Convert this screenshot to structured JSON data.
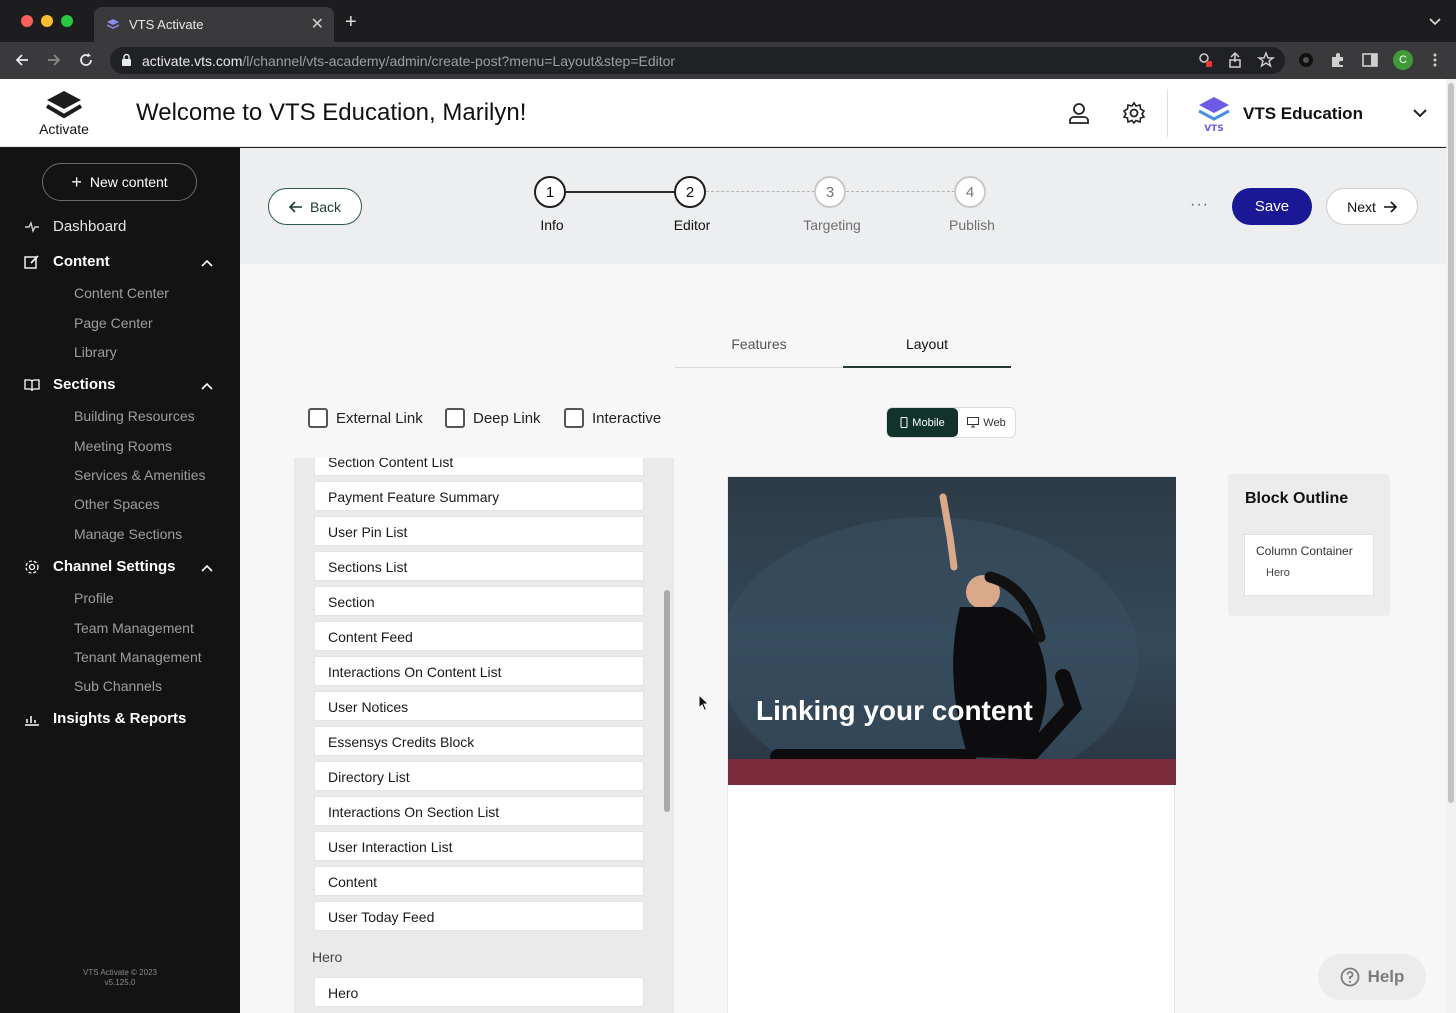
{
  "browser": {
    "tab_title": "VTS Activate",
    "url_host": "activate.vts.com",
    "url_path": "/l/channel/vts-academy/admin/create-post?menu=Layout&step=Editor",
    "profile_initial": "C"
  },
  "header": {
    "logo_text": "Activate",
    "welcome": "Welcome to VTS Education, Marilyn!",
    "org_name": "VTS Education"
  },
  "sidebar": {
    "new_content": "New content",
    "dashboard": "Dashboard",
    "content": "Content",
    "content_items": [
      "Content Center",
      "Page Center",
      "Library"
    ],
    "sections": "Sections",
    "sections_items": [
      "Building Resources",
      "Meeting Rooms",
      "Services & Amenities",
      "Other Spaces",
      "Manage Sections"
    ],
    "channel_settings": "Channel Settings",
    "channel_items": [
      "Profile",
      "Team Management",
      "Tenant Management",
      "Sub Channels"
    ],
    "insights": "Insights & Reports",
    "footer_line1": "VTS Activate © 2023",
    "footer_line2": "v5.125.0"
  },
  "stepper": {
    "back": "Back",
    "steps": [
      {
        "num": "1",
        "label": "Info"
      },
      {
        "num": "2",
        "label": "Editor"
      },
      {
        "num": "3",
        "label": "Targeting"
      },
      {
        "num": "4",
        "label": "Publish"
      }
    ],
    "more": "···",
    "save": "Save",
    "next": "Next"
  },
  "tabs": {
    "features": "Features",
    "layout": "Layout"
  },
  "filters": {
    "external_link": "External Link",
    "deep_link": "Deep Link",
    "interactive": "Interactive"
  },
  "view_toggle": {
    "mobile": "Mobile",
    "web": "Web"
  },
  "blocks": {
    "partial_item": "Section Content List",
    "items": [
      "Payment Feature Summary",
      "User Pin List",
      "Sections List",
      "Section",
      "Content Feed",
      "Interactions On Content List",
      "User Notices",
      "Essensys Credits Block",
      "Directory List",
      "Interactions On Section List",
      "User Interaction List",
      "Content",
      "User Today Feed"
    ],
    "hero_group": "Hero",
    "hero_item": "Hero"
  },
  "preview": {
    "hero_title": "Linking your content"
  },
  "outline": {
    "title": "Block Outline",
    "container": "Column Container",
    "child": "Hero"
  },
  "help": "Help"
}
